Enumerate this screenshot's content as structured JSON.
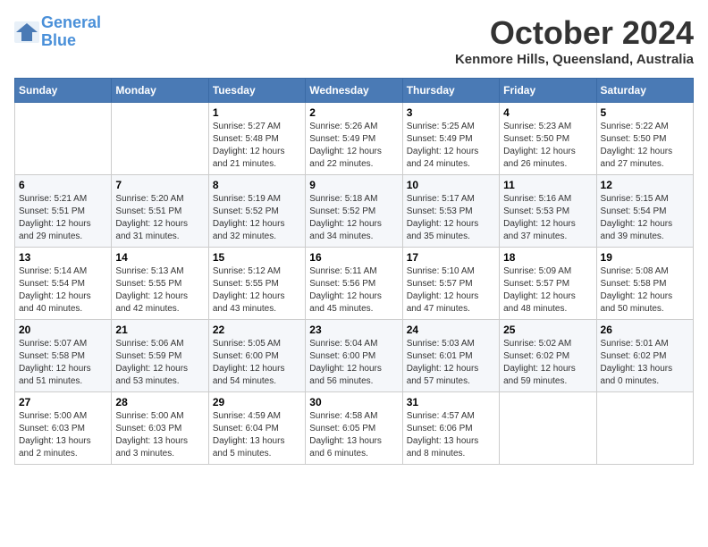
{
  "header": {
    "logo_line1": "General",
    "logo_line2": "Blue",
    "month": "October 2024",
    "location": "Kenmore Hills, Queensland, Australia"
  },
  "days_of_week": [
    "Sunday",
    "Monday",
    "Tuesday",
    "Wednesday",
    "Thursday",
    "Friday",
    "Saturday"
  ],
  "weeks": [
    [
      {
        "day": "",
        "info": ""
      },
      {
        "day": "",
        "info": ""
      },
      {
        "day": "1",
        "info": "Sunrise: 5:27 AM\nSunset: 5:48 PM\nDaylight: 12 hours and 21 minutes."
      },
      {
        "day": "2",
        "info": "Sunrise: 5:26 AM\nSunset: 5:49 PM\nDaylight: 12 hours and 22 minutes."
      },
      {
        "day": "3",
        "info": "Sunrise: 5:25 AM\nSunset: 5:49 PM\nDaylight: 12 hours and 24 minutes."
      },
      {
        "day": "4",
        "info": "Sunrise: 5:23 AM\nSunset: 5:50 PM\nDaylight: 12 hours and 26 minutes."
      },
      {
        "day": "5",
        "info": "Sunrise: 5:22 AM\nSunset: 5:50 PM\nDaylight: 12 hours and 27 minutes."
      }
    ],
    [
      {
        "day": "6",
        "info": "Sunrise: 5:21 AM\nSunset: 5:51 PM\nDaylight: 12 hours and 29 minutes."
      },
      {
        "day": "7",
        "info": "Sunrise: 5:20 AM\nSunset: 5:51 PM\nDaylight: 12 hours and 31 minutes."
      },
      {
        "day": "8",
        "info": "Sunrise: 5:19 AM\nSunset: 5:52 PM\nDaylight: 12 hours and 32 minutes."
      },
      {
        "day": "9",
        "info": "Sunrise: 5:18 AM\nSunset: 5:52 PM\nDaylight: 12 hours and 34 minutes."
      },
      {
        "day": "10",
        "info": "Sunrise: 5:17 AM\nSunset: 5:53 PM\nDaylight: 12 hours and 35 minutes."
      },
      {
        "day": "11",
        "info": "Sunrise: 5:16 AM\nSunset: 5:53 PM\nDaylight: 12 hours and 37 minutes."
      },
      {
        "day": "12",
        "info": "Sunrise: 5:15 AM\nSunset: 5:54 PM\nDaylight: 12 hours and 39 minutes."
      }
    ],
    [
      {
        "day": "13",
        "info": "Sunrise: 5:14 AM\nSunset: 5:54 PM\nDaylight: 12 hours and 40 minutes."
      },
      {
        "day": "14",
        "info": "Sunrise: 5:13 AM\nSunset: 5:55 PM\nDaylight: 12 hours and 42 minutes."
      },
      {
        "day": "15",
        "info": "Sunrise: 5:12 AM\nSunset: 5:55 PM\nDaylight: 12 hours and 43 minutes."
      },
      {
        "day": "16",
        "info": "Sunrise: 5:11 AM\nSunset: 5:56 PM\nDaylight: 12 hours and 45 minutes."
      },
      {
        "day": "17",
        "info": "Sunrise: 5:10 AM\nSunset: 5:57 PM\nDaylight: 12 hours and 47 minutes."
      },
      {
        "day": "18",
        "info": "Sunrise: 5:09 AM\nSunset: 5:57 PM\nDaylight: 12 hours and 48 minutes."
      },
      {
        "day": "19",
        "info": "Sunrise: 5:08 AM\nSunset: 5:58 PM\nDaylight: 12 hours and 50 minutes."
      }
    ],
    [
      {
        "day": "20",
        "info": "Sunrise: 5:07 AM\nSunset: 5:58 PM\nDaylight: 12 hours and 51 minutes."
      },
      {
        "day": "21",
        "info": "Sunrise: 5:06 AM\nSunset: 5:59 PM\nDaylight: 12 hours and 53 minutes."
      },
      {
        "day": "22",
        "info": "Sunrise: 5:05 AM\nSunset: 6:00 PM\nDaylight: 12 hours and 54 minutes."
      },
      {
        "day": "23",
        "info": "Sunrise: 5:04 AM\nSunset: 6:00 PM\nDaylight: 12 hours and 56 minutes."
      },
      {
        "day": "24",
        "info": "Sunrise: 5:03 AM\nSunset: 6:01 PM\nDaylight: 12 hours and 57 minutes."
      },
      {
        "day": "25",
        "info": "Sunrise: 5:02 AM\nSunset: 6:02 PM\nDaylight: 12 hours and 59 minutes."
      },
      {
        "day": "26",
        "info": "Sunrise: 5:01 AM\nSunset: 6:02 PM\nDaylight: 13 hours and 0 minutes."
      }
    ],
    [
      {
        "day": "27",
        "info": "Sunrise: 5:00 AM\nSunset: 6:03 PM\nDaylight: 13 hours and 2 minutes."
      },
      {
        "day": "28",
        "info": "Sunrise: 5:00 AM\nSunset: 6:03 PM\nDaylight: 13 hours and 3 minutes."
      },
      {
        "day": "29",
        "info": "Sunrise: 4:59 AM\nSunset: 6:04 PM\nDaylight: 13 hours and 5 minutes."
      },
      {
        "day": "30",
        "info": "Sunrise: 4:58 AM\nSunset: 6:05 PM\nDaylight: 13 hours and 6 minutes."
      },
      {
        "day": "31",
        "info": "Sunrise: 4:57 AM\nSunset: 6:06 PM\nDaylight: 13 hours and 8 minutes."
      },
      {
        "day": "",
        "info": ""
      },
      {
        "day": "",
        "info": ""
      }
    ]
  ]
}
